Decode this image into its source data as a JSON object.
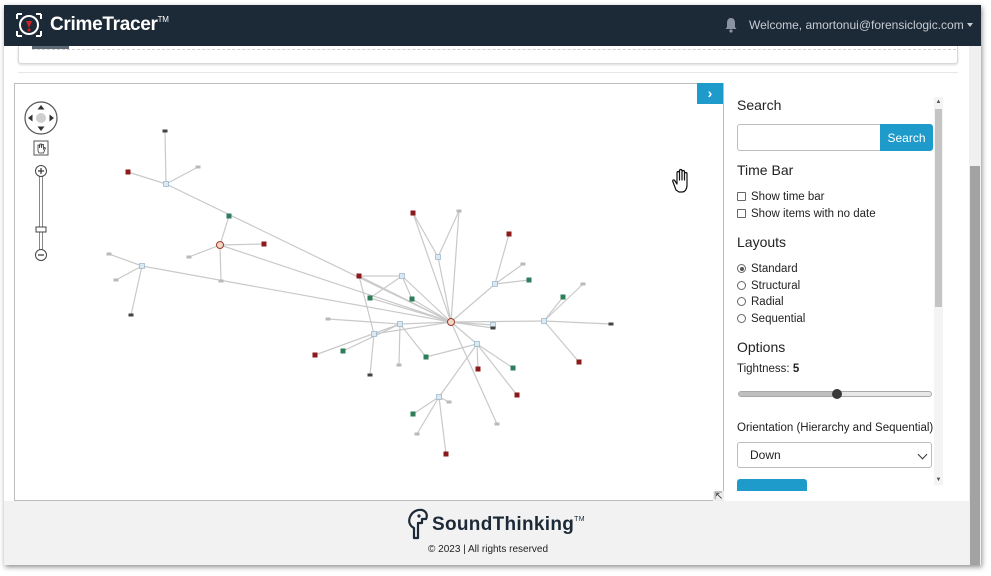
{
  "app": {
    "brand_name": "CrimeTracer",
    "brand_mark": "TM",
    "welcome_text": "Welcome, amortonui@forensiclogic.com"
  },
  "graph": {
    "toggle_icon": "chevron-right-icon",
    "nav_icon": "pan-compass-icon",
    "zoom_in_icon": "plus-icon",
    "zoom_out_icon": "minus-icon",
    "cursor_icon": "hand-cursor-icon"
  },
  "panel": {
    "search": {
      "heading": "Search",
      "placeholder": "",
      "button": "Search"
    },
    "time_bar": {
      "heading": "Time Bar",
      "options": [
        {
          "label": "Show time bar",
          "checked": false
        },
        {
          "label": "Show items with no date",
          "checked": false
        }
      ]
    },
    "layouts": {
      "heading": "Layouts",
      "options": [
        {
          "label": "Standard",
          "selected": true
        },
        {
          "label": "Structural",
          "selected": false
        },
        {
          "label": "Radial",
          "selected": false
        },
        {
          "label": "Sequential",
          "selected": false
        }
      ]
    },
    "options": {
      "heading": "Options",
      "tightness_label": "Tightness:",
      "tightness_value": "5",
      "tightness_fraction": 0.5,
      "orientation_label": "Orientation (Hierarchy and Sequential)",
      "orientation_value": "Down"
    }
  },
  "footer": {
    "company_name": "SoundThinking",
    "company_mark": "TM",
    "copyright": "© 2023 | All rights reserved"
  },
  "colors": {
    "topbar": "#1c2937",
    "accent": "#1e9acb",
    "node_red": "#8b1a1a",
    "node_green": "#2e7d5b",
    "edge": "#c9c9c9"
  }
}
